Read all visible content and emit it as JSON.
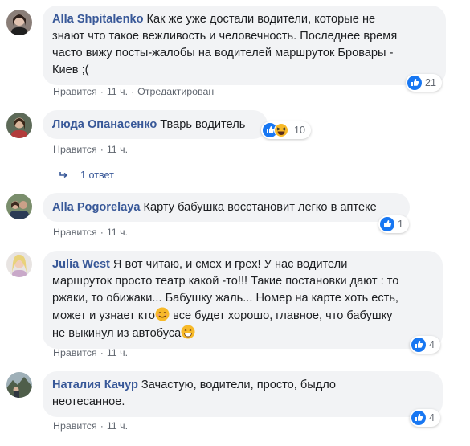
{
  "comments": [
    {
      "author": "Alla Shpitalenko",
      "text_lines": [
        "Как же уже достали водители, которые не",
        "знают что такое вежливость и человечность. Последнее время",
        "часто вижу посты-жалобы на водителей маршруток Бровары -",
        "Киев ;("
      ],
      "like_label": "Нравится",
      "time": "11 ч.",
      "edited": "Отредактирован",
      "reaction_count": "21",
      "reaction_type": "like-icon"
    },
    {
      "author": "Люда Опанасенко",
      "text": "Тварь водитель",
      "like_label": "Нравится",
      "time": "11 ч.",
      "reaction_count": "10",
      "reaction_type": "haha-icon",
      "replies_label": "1 ответ"
    },
    {
      "author": "Alla Pogorelaya",
      "text": "Карту бабушка восстановит легко в аптеке",
      "like_label": "Нравится",
      "time": "11 ч.",
      "reaction_count": "1",
      "reaction_type": "like-icon"
    },
    {
      "author": "Julia West",
      "text_lines": [
        "Я вот читаю, и смех и грех! У нас водители",
        "маршруток просто театр какой -то!!! Такие постановки дают : то",
        "ржаки, то обижаки... Бабушку жаль... Номер на карте хоть есть,",
        "может и узнает кто",
        " все будет хорошо, главное, что бабушку",
        "не выкинул из автобуса"
      ],
      "like_label": "Нравится",
      "time": "11 ч.",
      "reaction_count": "4",
      "reaction_type": "like-icon"
    },
    {
      "author": "Наталия Качур",
      "text_lines": [
        "Зачастую, водители, просто, быдло",
        "неотесанное."
      ],
      "like_label": "Нравится",
      "time": "11 ч.",
      "reaction_count": "4",
      "reaction_type": "like-icon"
    }
  ],
  "colors": {
    "author": "#385898",
    "bubble": "#f2f3f5",
    "meta": "#616770",
    "like_blue": "#1877f2",
    "haha_yellow": "#f7b928"
  }
}
